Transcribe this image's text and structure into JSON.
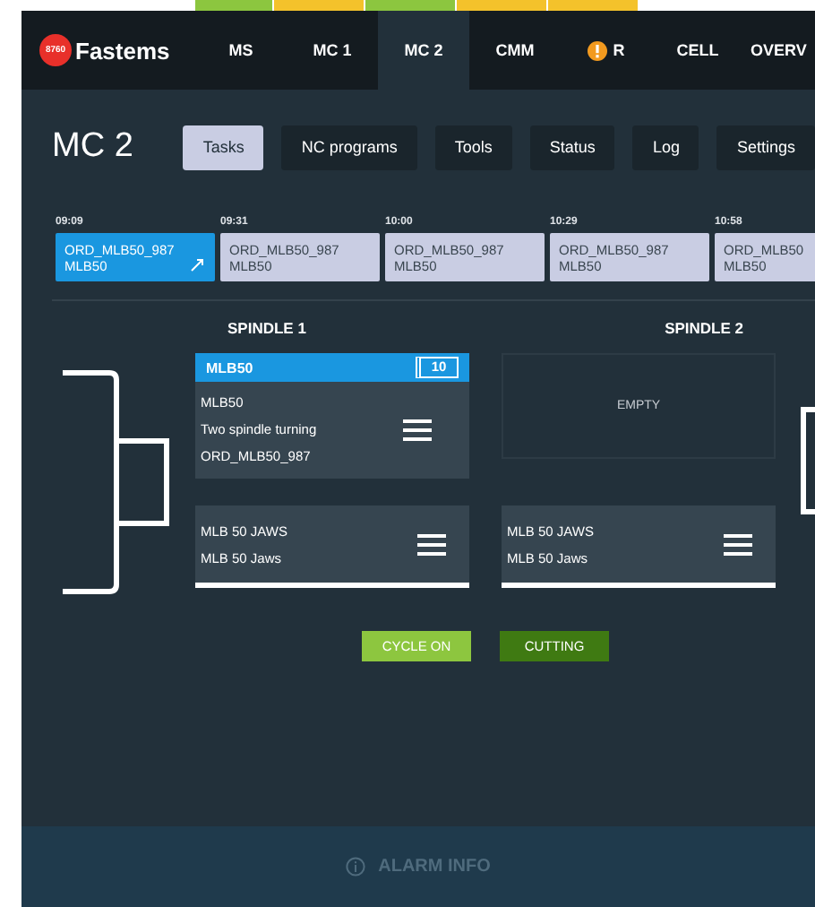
{
  "nav": {
    "logo_badge": "8760",
    "logo": "Fastems",
    "tabs": [
      {
        "label": "MS",
        "selected": false,
        "color": "#8cc63f",
        "alert": false
      },
      {
        "label": "MC 1",
        "selected": false,
        "color": "#f4c22b",
        "alert": false
      },
      {
        "label": "MC 2",
        "selected": true,
        "color": "#8cc63f",
        "alert": false
      },
      {
        "label": "CMM",
        "selected": false,
        "color": "#f4c22b",
        "alert": false
      },
      {
        "label": "R",
        "selected": false,
        "color": "#f4c22b",
        "alert": true
      },
      {
        "label": "CELL",
        "selected": false,
        "alert": false
      },
      {
        "label": "OVERV",
        "selected": false,
        "alert": false
      }
    ]
  },
  "page": {
    "title": "MC 2",
    "tabs": [
      {
        "label": "Tasks",
        "selected": true
      },
      {
        "label": "NC programs",
        "selected": false
      },
      {
        "label": "Tools",
        "selected": false
      },
      {
        "label": "Status",
        "selected": false
      },
      {
        "label": "Log",
        "selected": false
      },
      {
        "label": "Settings",
        "selected": false
      }
    ]
  },
  "tasks": [
    {
      "time": "09:09",
      "order": "ORD_MLB50_987",
      "part": "MLB50",
      "selected": true
    },
    {
      "time": "09:31",
      "order": "ORD_MLB50_987",
      "part": "MLB50",
      "selected": false
    },
    {
      "time": "10:00",
      "order": "ORD_MLB50_987",
      "part": "MLB50",
      "selected": false
    },
    {
      "time": "10:29",
      "order": "ORD_MLB50_987",
      "part": "MLB50",
      "selected": false
    },
    {
      "time": "10:58",
      "order": "ORD_MLB50",
      "part": "MLB50",
      "selected": false
    }
  ],
  "spindles": [
    {
      "label": "SPINDLE 1",
      "kind": "loaded",
      "part": "MLB50",
      "count": "10",
      "lines": [
        "MLB50",
        "Two spindle turning",
        "ORD_MLB50_987"
      ],
      "fixture": [
        "MLB 50 JAWS",
        "MLB 50 Jaws"
      ]
    },
    {
      "label": "SPINDLE 2",
      "kind": "empty",
      "empty_text": "EMPTY",
      "fixture": [
        "MLB 50 JAWS",
        "MLB 50 Jaws"
      ]
    }
  ],
  "status": [
    {
      "label": "CYCLE ON",
      "color": "#8dc63f"
    },
    {
      "label": "CUTTING",
      "color": "#3f7a12"
    }
  ],
  "footer": {
    "label": "ALARM INFO"
  }
}
